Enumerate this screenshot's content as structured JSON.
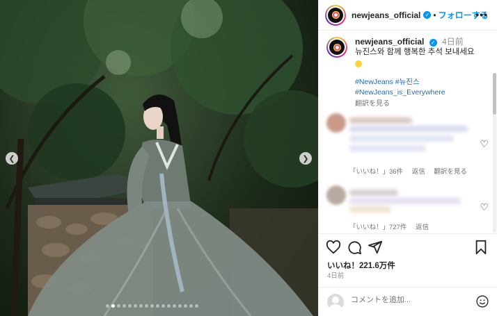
{
  "post": {
    "username": "newjeans_official",
    "follow_label": "フォローする",
    "more_label": "•••",
    "separator": "•"
  },
  "caption": {
    "username": "newjeans_official",
    "time": "4日前",
    "text": "뉴진스와 함께 행복한 추석 보내세요",
    "hashtags_line1": "#NewJeans #뉴진스",
    "hashtags_line2": "#NewJeans_is_Everywhere",
    "translate_label": "翻訳を見る"
  },
  "comments": [
    {
      "likes_label": "「いいね！」36件",
      "reply_label": "返信",
      "translate_label": "翻訳を見る"
    },
    {
      "likes_label": "「いいね！」727件",
      "reply_label": "返信"
    }
  ],
  "stats": {
    "likes": "いいね！221.6万件",
    "date": "4日前"
  },
  "comment_box": {
    "placeholder": "コメントを追加..."
  },
  "carousel": {
    "slide_count": 17,
    "active_index": 1
  },
  "icons": {
    "like": "heart-icon",
    "comment": "comment-icon",
    "share": "send-icon",
    "save": "bookmark-icon",
    "emoji": "smile-icon",
    "prev": "chevron-left-icon",
    "next": "chevron-right-icon"
  },
  "colors": {
    "accent": "#0095f6",
    "hashtag": "#1d6bb6",
    "muted": "#737373"
  }
}
